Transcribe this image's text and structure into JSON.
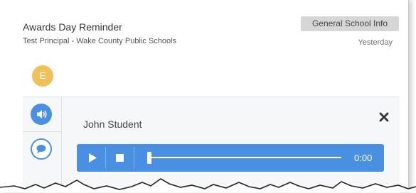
{
  "message": {
    "title": "Awards Day Reminder",
    "sender_line": "Test Principal - Wake County Public Schools",
    "category_tag": "General School Info",
    "timestamp": "Yesterday",
    "avatar_initial": "E"
  },
  "conversation": {
    "sender_name": "John Student",
    "player": {
      "time": "0:00",
      "progress": 0
    }
  },
  "icons": {
    "audio_tab": "speaker-icon",
    "message_tab": "speech-bubble-icon",
    "close": "close-icon",
    "play": "play-icon",
    "stop": "stop-icon"
  },
  "colors": {
    "accent": "#4a90e2",
    "avatar": "#efc15a",
    "tag_bg": "#d6d6d6"
  }
}
